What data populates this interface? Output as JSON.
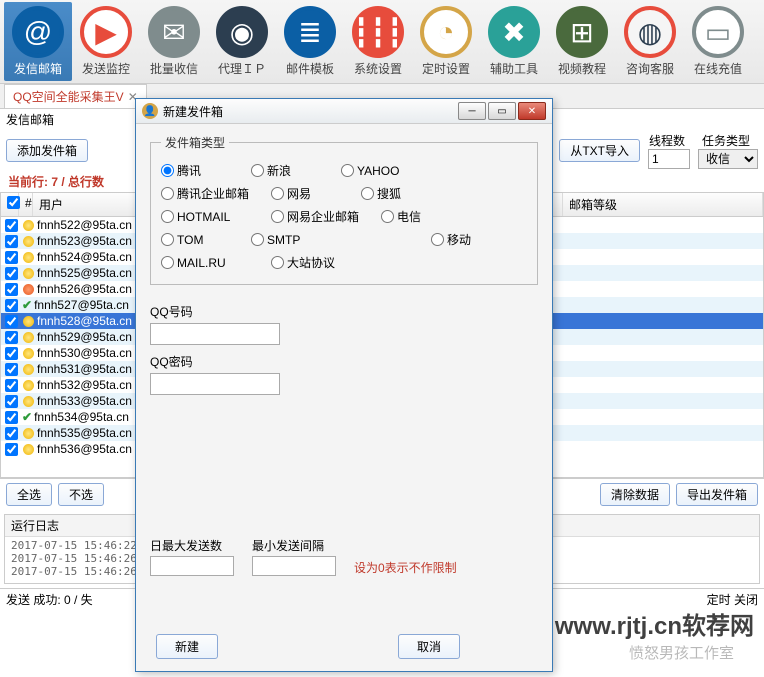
{
  "toolbar": [
    {
      "label": "发信邮箱",
      "glyph": "@",
      "cls": "ic-at",
      "active": true
    },
    {
      "label": "发送监控",
      "glyph": "▶",
      "cls": "ic-mon"
    },
    {
      "label": "批量收信",
      "glyph": "✉",
      "cls": "ic-mail"
    },
    {
      "label": "代理ＩＰ",
      "glyph": "◉",
      "cls": "ic-proxy"
    },
    {
      "label": "邮件模板",
      "glyph": "≣",
      "cls": "ic-tmpl"
    },
    {
      "label": "系统设置",
      "glyph": "┇┇┇",
      "cls": "ic-sys"
    },
    {
      "label": "定时设置",
      "glyph": "◔",
      "cls": "ic-time"
    },
    {
      "label": "辅助工具",
      "glyph": "✖",
      "cls": "ic-tool"
    },
    {
      "label": "视频教程",
      "glyph": "⊞",
      "cls": "ic-vid"
    },
    {
      "label": "咨询客服",
      "glyph": "◍",
      "cls": "ic-help"
    },
    {
      "label": "在线充值",
      "glyph": "▭",
      "cls": "ic-pay"
    }
  ],
  "tab_title": "QQ空间全能采集王V",
  "panel_label": "发信邮箱",
  "add_sender_btn": "添加发件箱",
  "import_txt_btn": "从TXT导入",
  "threads_label": "线程数",
  "threads_value": "1",
  "tasktype_label": "任务类型",
  "tasktype_value": "收信",
  "status_line": "当前行: 7 / 总行数",
  "columns": {
    "idx": "#",
    "user": "用户",
    "grade": "邮箱等级"
  },
  "rows": [
    {
      "user": "fnnh522@95ta.cn",
      "state": "y"
    },
    {
      "user": "fnnh523@95ta.cn",
      "state": "y"
    },
    {
      "user": "fnnh524@95ta.cn",
      "state": "y"
    },
    {
      "user": "fnnh525@95ta.cn",
      "state": "y"
    },
    {
      "user": "fnnh526@95ta.cn",
      "state": "r"
    },
    {
      "user": "fnnh527@95ta.cn",
      "state": "ok"
    },
    {
      "user": "fnnh528@95ta.cn",
      "state": "y",
      "sel": true
    },
    {
      "user": "fnnh529@95ta.cn",
      "state": "y"
    },
    {
      "user": "fnnh530@95ta.cn",
      "state": "y"
    },
    {
      "user": "fnnh531@95ta.cn",
      "state": "y"
    },
    {
      "user": "fnnh532@95ta.cn",
      "state": "y"
    },
    {
      "user": "fnnh533@95ta.cn",
      "state": "y"
    },
    {
      "user": "fnnh534@95ta.cn",
      "state": "ok"
    },
    {
      "user": "fnnh535@95ta.cn",
      "state": "y"
    },
    {
      "user": "fnnh536@95ta.cn",
      "state": "y"
    }
  ],
  "btn_all": "全选",
  "btn_none": "不选",
  "btn_clear": "清除数据",
  "btn_export": "导出发件箱",
  "log_title": "运行日志",
  "logs": [
    "2017-07-15 15:46:22 =>",
    "2017-07-15 15:46:26 =>",
    "2017-07-15 15:46:26 =>"
  ],
  "send_result": "发送 成功: 0 / 失",
  "footer_timed": "定时 关闭",
  "modal": {
    "title": "新建发件箱",
    "group_label": "发件箱类型",
    "types": [
      "腾讯",
      "新浪",
      "YAHOO",
      "腾讯企业邮箱",
      "网易",
      "搜狐",
      "HOTMAIL",
      "网易企业邮箱",
      "电信",
      "TOM",
      "SMTP",
      "",
      "移动",
      "MAIL.RU",
      "大站协议",
      ""
    ],
    "selected_type": "腾讯",
    "qq_number_label": "QQ号码",
    "qq_password_label": "QQ密码",
    "max_send_label": "日最大发送数",
    "min_interval_label": "最小发送间隔",
    "limit_note": "设为0表示不作限制",
    "ok": "新建",
    "cancel": "取消"
  },
  "watermark1": "www.rjtj.cn软荐网",
  "watermark2": "愤怒男孩工作室"
}
